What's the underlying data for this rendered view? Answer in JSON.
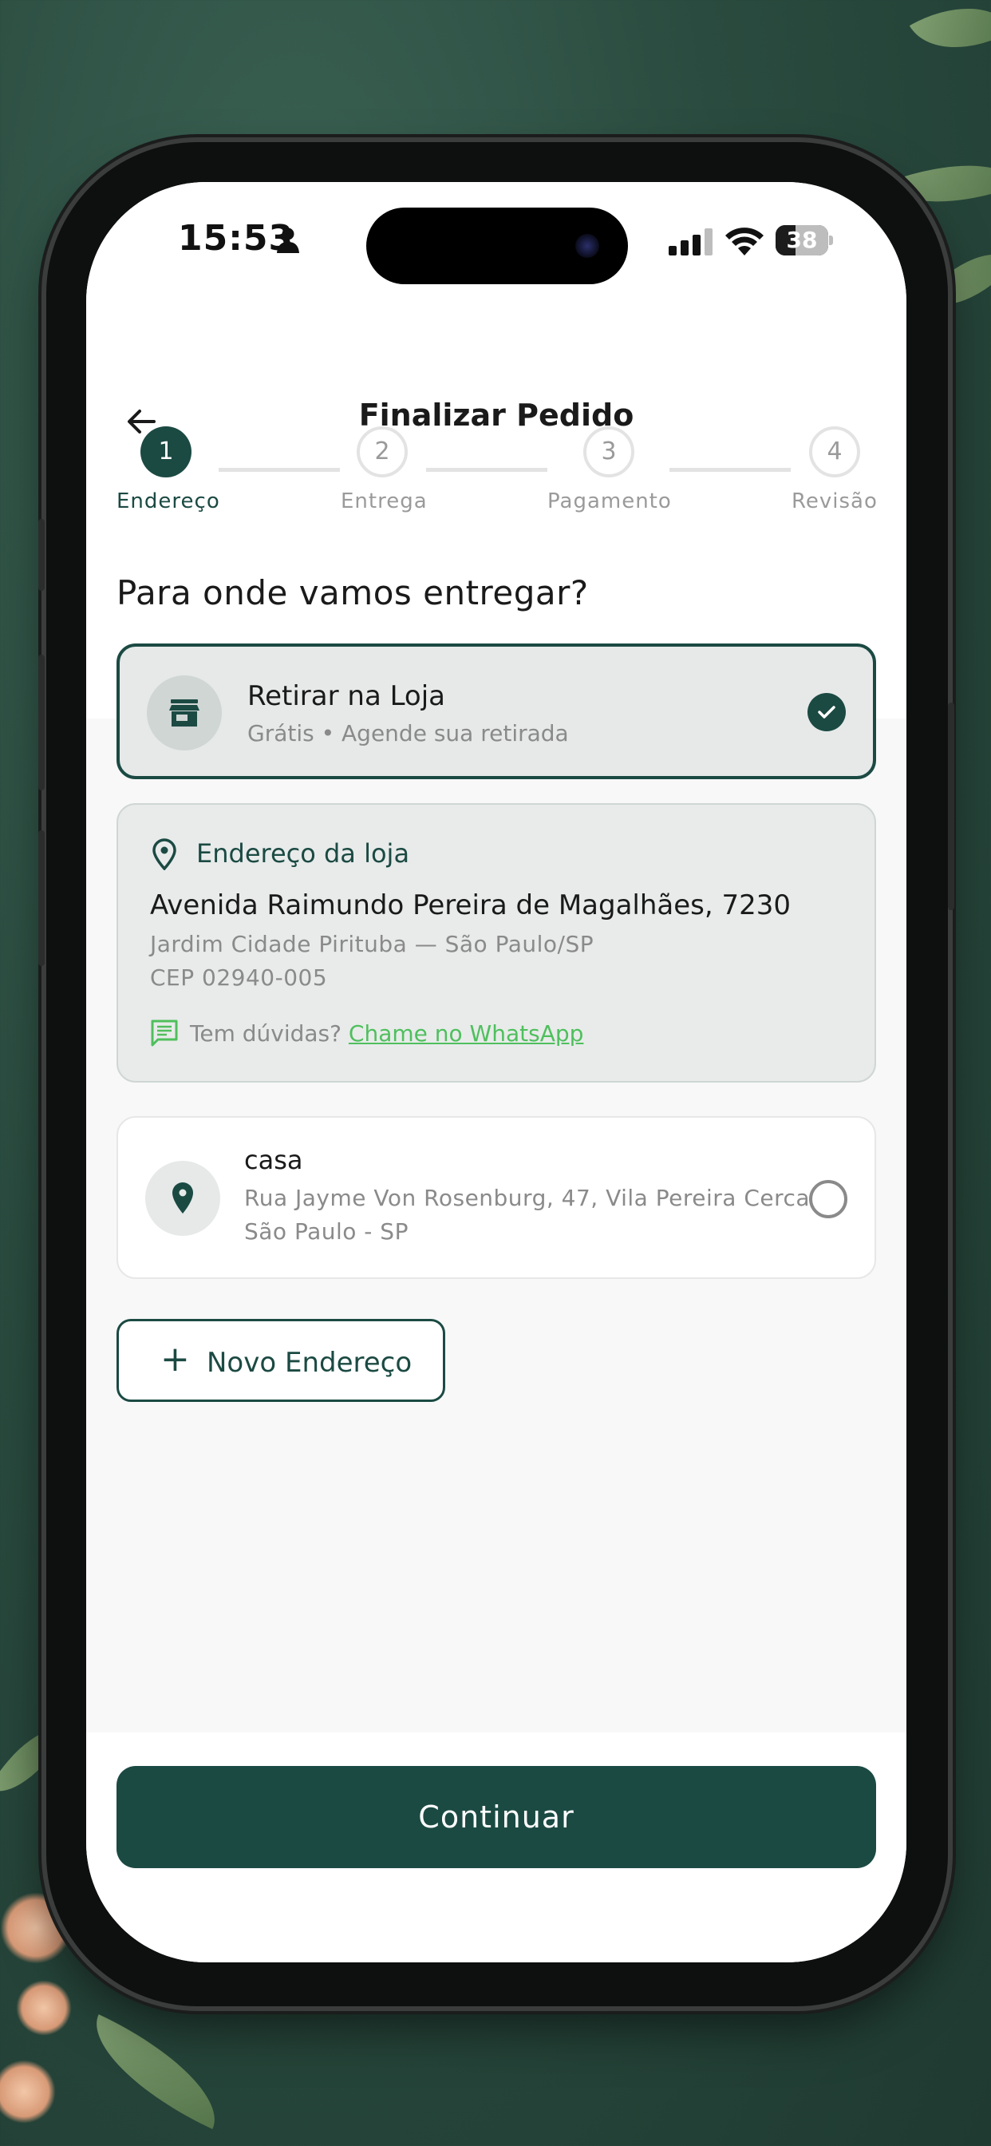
{
  "status_bar": {
    "time": "15:53",
    "battery": "38",
    "battery_level": 0.38
  },
  "header": {
    "title": "Finalizar Pedido"
  },
  "steps": [
    {
      "number": "1",
      "label": "Endereço",
      "active": true
    },
    {
      "number": "2",
      "label": "Entrega",
      "active": false
    },
    {
      "number": "3",
      "label": "Pagamento",
      "active": false
    },
    {
      "number": "4",
      "label": "Revisão",
      "active": false
    }
  ],
  "main": {
    "question": "Para onde vamos entregar?",
    "pickup_option": {
      "title": "Retirar na Loja",
      "subtitle": "Grátis • Agende sua retirada",
      "selected": true
    },
    "store_address": {
      "heading": "Endereço da loja",
      "line1": "Avenida Raimundo Pereira de Magalhães, 7230",
      "line2": "Jardim Cidade Pirituba — São Paulo/SP",
      "line3": "CEP 02940-005",
      "help_text": "Tem dúvidas?",
      "help_link": "Chame no WhatsApp"
    },
    "home_option": {
      "title": "casa",
      "line1": "Rua Jayme Von Rosenburg, 47, Vila Pereira Cerca,",
      "line2": "São Paulo - SP",
      "selected": false
    },
    "new_address_button": "Novo Endereço"
  },
  "footer": {
    "continue_button": "Continuar"
  },
  "colors": {
    "primary": "#1b4a43",
    "link": "#4fbf5d",
    "muted": "#8a8a8a"
  }
}
